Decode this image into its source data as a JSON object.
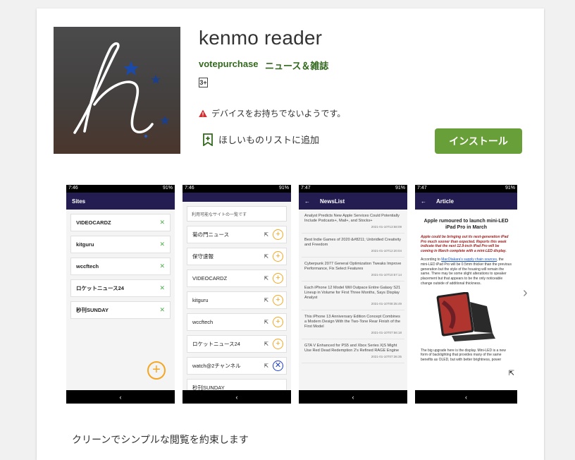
{
  "app": {
    "title": "kenmo reader",
    "developer": "votepurchase",
    "category": "ニュース＆雑誌",
    "rating": "3+",
    "warning": "デバイスをお持ちでないようです。",
    "wishlist_label": "ほしいものリストに追加",
    "install_label": "インストール",
    "description": "クリーンでシンプルな閲覧を約束します"
  },
  "screenshots": {
    "s1": {
      "time": "7:46",
      "battery": "91%",
      "title": "Sites",
      "items": [
        "VIDEOCARDZ",
        "kitguru",
        "wccftech",
        "ロケットニュース24",
        "秒刊SUNDAY"
      ]
    },
    "s2": {
      "time": "7:46",
      "battery": "91%",
      "header": "利用可能なサイトの一覧です",
      "items": [
        "菊の門ニュース",
        "保守速報",
        "VIDEOCARDZ",
        "kitguru",
        "wccftech",
        "ロケットニュース24",
        "watch@2チャンネル",
        "秒刊SUNDAY"
      ]
    },
    "s3": {
      "time": "7:47",
      "battery": "91%",
      "title": "NewsList",
      "items": [
        {
          "title": "Analyst Predicts New Apple Services Could Potentially Include Podcasts+, Mail+, and Stocks+",
          "date": "2021-01-10T13:58:09"
        },
        {
          "title": "Best Indie Games of 2020 &#8211; Unbridled Creativity and Freedom",
          "date": "2021-01-10T12:20:04"
        },
        {
          "title": "Cyberpunk 2077 General Optimization Tweaks Improve Performance, Fix Select Features",
          "date": "2021-01-10T10:57:14"
        },
        {
          "title": "Each iPhone 12 Model Will Outpace Entire Galaxy S21 Lineup in Volume for First Three Months, Says Display Analyst",
          "date": "2021-01-10T08:35:49"
        },
        {
          "title": "This iPhone 13 Anniversary Edition Concept Combines a Modern Design With the Two-Tone Rear Finish of the First Model",
          "date": "2021-01-10T07:56:18"
        },
        {
          "title": "GTA V Enhanced for PS5 and Xbox Series X|S Might Use Red Dead Redemption 2's Refined RAGE Engine",
          "date": "2021-01-10T07:36:35"
        }
      ]
    },
    "s4": {
      "time": "7:47",
      "battery": "91%",
      "title": "Article",
      "headline": "Apple rumoured to launch mini-LED iPad Pro in March",
      "lead": "Apple could be bringing out its next-generation iPad Pro much sooner than expected. Reports this week indicate that the next 12.9-inch iPad Pro will be coming in March complete with a mini-LED display.",
      "body_prefix": "According to ",
      "body_link": "MacOtakara's supply chain sources",
      "body_rest": ", the mini-LED iPad Pro will be 0.5mm thicker than the previous generation but the style of the housing will remain the same. There may be some slight alterations to speaker placement but that appears to be the only noticeable change outside of additional thickness.",
      "body2": "The big upgrade here is the display. Mini-LED is a new form of backlighting that provides many of the same benefits as OLED, but with better brightness, power"
    }
  },
  "colors": {
    "accent": "#689f38",
    "link": "#33691e",
    "appbar": "#241d52",
    "fab": "#f5a623"
  }
}
